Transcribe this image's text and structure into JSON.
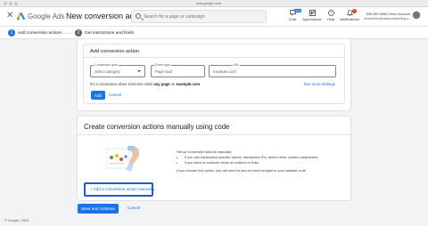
{
  "browser": {
    "url": "ads.google.com"
  },
  "header": {
    "brand": "Google Ads",
    "page_title": "New conversion action",
    "search_placeholder": "Search for a page or campaign",
    "icons": [
      {
        "name": "chat-icon",
        "label": "Chat",
        "badge": "New"
      },
      {
        "name": "appearance-icon",
        "label": "Appearance"
      },
      {
        "name": "help-icon",
        "label": "Help"
      },
      {
        "name": "notifications-icon",
        "label": "Notifications",
        "count": "2"
      }
    ],
    "account": {
      "id": "838-399-6856 Demo Account",
      "email": "luciarollins@data-marketing-s..."
    }
  },
  "steps": [
    {
      "num": "1",
      "label": "Add conversion actions",
      "active": true
    },
    {
      "num": "2",
      "label": "Get instructions and finish",
      "active": false
    }
  ],
  "add_section": {
    "title": "Add conversion action",
    "goal_label": "Conversion goal",
    "goal_value": "Select category",
    "event_label": "Event type",
    "event_value": "Page load",
    "url_label": "URL",
    "url_placeholder": "example.com/",
    "hint_prefix": "It's a conversion when someone visits",
    "hint_bold1": "any page",
    "hint_mid": "on",
    "hint_bold2": "example.com",
    "more_settings": "See more settings",
    "add_button": "Add",
    "cancel_button": "Cancel"
  },
  "manual_section": {
    "title": "Create conversion actions manually using code",
    "intro": "Set up conversion actions manually:",
    "bullets": [
      "If you use transaction-specific values, transaction IDs, and/or other custom parameters.",
      "If you want to measure clicks on buttons or links."
    ],
    "note": "If you choose this option, you will need to add an event snippet to your website code",
    "add_manual_button": "+ Add a conversion action manually"
  },
  "footer": {
    "save_button": "Save and continue",
    "cancel_button": "Cancel",
    "copyright": "© Google, 2023."
  },
  "colors": {
    "primary": "#1a73e8",
    "background": "#f1f3f4"
  }
}
